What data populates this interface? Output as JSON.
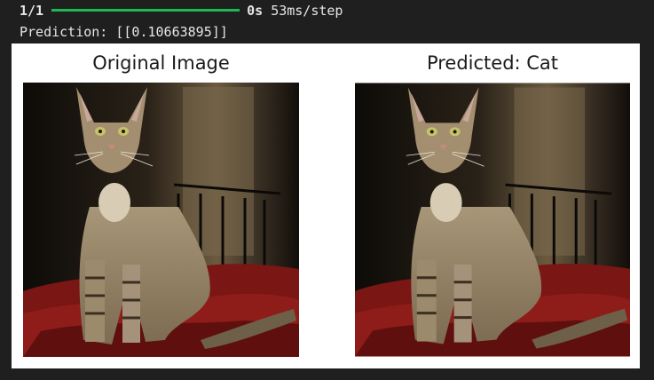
{
  "console": {
    "step_count": "1/1",
    "elapsed": "0s",
    "rate": "53ms/step",
    "prediction_line": "Prediction: [[0.10663895]]"
  },
  "figure": {
    "left_title": "Original Image",
    "right_title": "Predicted: Cat"
  },
  "colors": {
    "progress_bar": "#1db954",
    "console_bg": "#1f1f1f",
    "figure_bg": "#ffffff"
  }
}
